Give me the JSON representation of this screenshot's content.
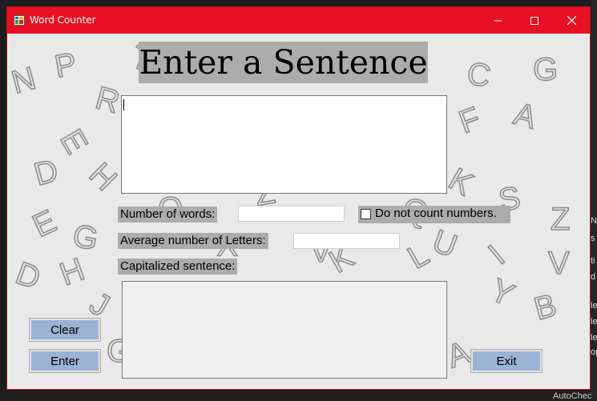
{
  "window": {
    "title": "Word Counter",
    "buttons": {
      "minimize_icon": "minimize-icon",
      "maximize_icon": "maximize-icon",
      "close_icon": "close-icon"
    }
  },
  "form": {
    "heading": "Enter a Sentence",
    "sentence_input": {
      "value": ""
    },
    "words_label": "Number of words:",
    "words_value": "",
    "checkbox_label": "Do not count numbers.",
    "checkbox_checked": false,
    "avg_label": "Average number of Letters:",
    "avg_value": "",
    "capitalized_label": "Capitalized sentence:",
    "capitalized_value": ""
  },
  "buttons": {
    "clear": "Clear",
    "enter": "Enter",
    "exit": "Exit"
  },
  "background_letters": [
    "N",
    "P",
    "T",
    "R",
    "E",
    "D",
    "H",
    "E",
    "G",
    "D",
    "H",
    "C",
    "G",
    "A",
    "F",
    "K",
    "S",
    "Z",
    "U",
    "I",
    "V",
    "Y",
    "B",
    "O",
    "Q",
    "Y",
    "V",
    "K",
    "L",
    "A",
    "G",
    "J",
    "Z"
  ],
  "ide_background": {
    "side_text": [
      "N",
      "s",
      "ti",
      "d",
      "le",
      "le",
      "le",
      "op"
    ],
    "below_text": "AutoChec"
  },
  "colors": {
    "titlebar": "#e81123",
    "form_back": "#e9e9e9",
    "label_back": "#acacac",
    "button_face": "#9ab3d4"
  }
}
